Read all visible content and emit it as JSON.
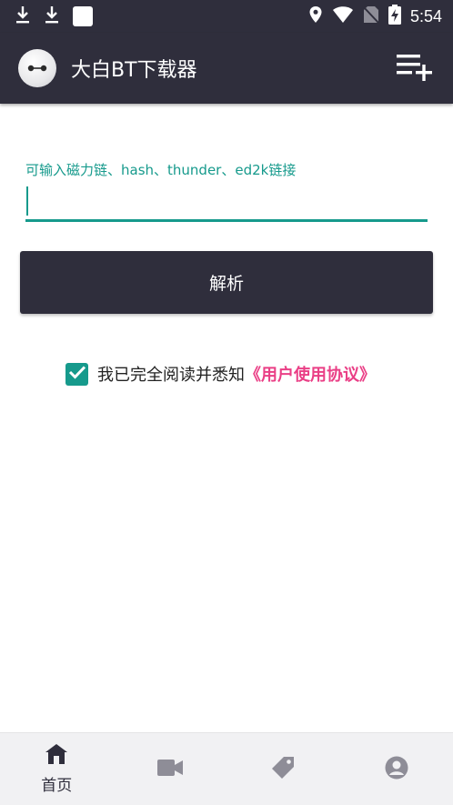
{
  "status_bar": {
    "time": "5:54",
    "icons": [
      "download-icon",
      "download-icon",
      "notification-square-icon",
      "location-icon",
      "wifi-icon",
      "no-sim-icon",
      "battery-charging-icon"
    ]
  },
  "app_bar": {
    "title": "大白BT下载器",
    "action_icon": "playlist-add-icon"
  },
  "input": {
    "label": "可输入磁力链、hash、thunder、ed2k链接",
    "value": "",
    "placeholder": ""
  },
  "parse_button": {
    "label": "解析"
  },
  "agreement": {
    "checked": true,
    "text": "我已完全阅读并悉知",
    "link_text": "《用户使用协议》"
  },
  "bottom_nav": {
    "items": [
      {
        "icon": "home-icon",
        "label": "首页",
        "active": true
      },
      {
        "icon": "video-icon",
        "label": "",
        "active": false
      },
      {
        "icon": "tag-icon",
        "label": "",
        "active": false
      },
      {
        "icon": "profile-icon",
        "label": "",
        "active": false
      }
    ]
  },
  "colors": {
    "primary_dark": "#2f2e3c",
    "accent_teal": "#169a8c",
    "link_pink": "#ea3f86",
    "nav_inactive": "#8e8d97"
  }
}
